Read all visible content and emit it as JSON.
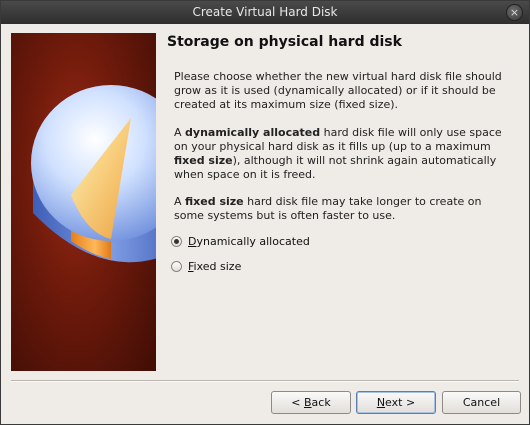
{
  "window": {
    "title": "Create Virtual Hard Disk",
    "close_glyph": "×"
  },
  "page": {
    "heading": "Storage on physical hard disk",
    "intro": "Please choose whether the new virtual hard disk file should grow as it is used (dynamically allocated) or if it should be created at its maximum size (fixed size).",
    "dynamic_desc": {
      "prefix": "A ",
      "bold": "dynamically allocated",
      "middle": " hard disk file will only use space on your physical hard disk as it fills up (up to a maximum ",
      "bold2": "fixed size",
      "suffix": "), although it will not shrink again automatically when space on it is freed."
    },
    "fixed_desc": {
      "prefix": "A ",
      "bold": "fixed size",
      "suffix": " hard disk file may take longer to create on some systems but is often faster to use."
    }
  },
  "options": [
    {
      "label_first": "D",
      "label_rest": "ynamically allocated",
      "checked": true
    },
    {
      "label_first": "F",
      "label_rest": "ixed size",
      "checked": false
    }
  ],
  "buttons": {
    "back": {
      "prefix": "< ",
      "mnemonic": "B",
      "rest": "ack"
    },
    "next": {
      "mnemonic": "N",
      "rest": "ext >"
    },
    "cancel": "Cancel"
  },
  "icons": {
    "close": "close-icon",
    "illustration": "hard-disk-pie-illustration"
  }
}
